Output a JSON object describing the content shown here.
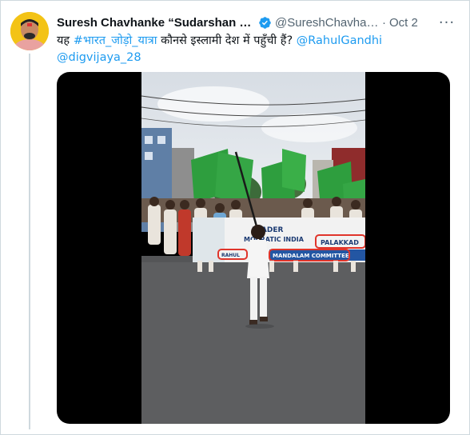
{
  "tweet": {
    "display_name": "Suresh Chavhanke “Sudarshan Ne...",
    "handle": "@SureshChavhan...",
    "separator": "·",
    "date": "Oct 2",
    "more_label": "···",
    "text": {
      "prefix": "यह ",
      "hashtag": "#भारत_जोड़ो_यात्रा",
      "middle": " कौनसे इस्लामी देश में पहुँची हैं? ",
      "mention1": "@RahulGandhi",
      "mention2": "@digvijaya_28"
    },
    "video_banner": {
      "line1": "LEADER",
      "line2": "MOCRATIC INDIA",
      "badge": "PALAKKAD",
      "bottom": "MANDALAM COMMITTEE",
      "left_tag": "RAHUL"
    }
  },
  "colors": {
    "link": "#1d9bf0",
    "verified": "#1d9bf0",
    "flag_green": "#2e9e3e"
  }
}
